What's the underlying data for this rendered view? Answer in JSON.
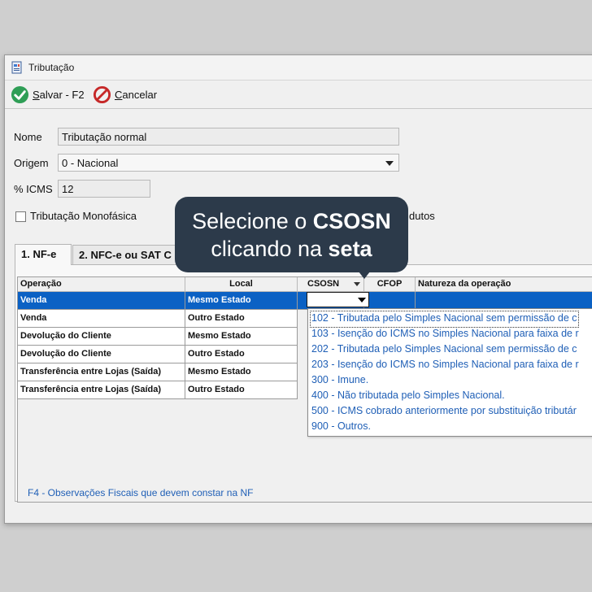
{
  "window": {
    "title": "Tributação",
    "icon": "tax-document-icon"
  },
  "toolbar": {
    "save_label": "alvar - F2",
    "save_accel": "S",
    "cancel_label": "ancelar",
    "cancel_accel": "C"
  },
  "form": {
    "nome_label": "Nome",
    "nome_value": "Tributação normal",
    "origem_label": "Origem",
    "origem_value": "0 - Nacional",
    "icms_label": "% ICMS",
    "icms_value": "12",
    "monofasica_label": "Tributação Monofásica",
    "monofasica_checked": false,
    "other_check_label_partial": "dutos"
  },
  "tabs": [
    {
      "label": "1. NF-e",
      "active": true
    },
    {
      "label": "2. NFC-e ou SAT C",
      "active": false
    }
  ],
  "grid": {
    "columns": [
      "Operação",
      "Local",
      "CSOSN",
      "CFOP",
      "Natureza da operação"
    ],
    "rows": [
      {
        "operacao": "Venda",
        "local": "Mesmo Estado",
        "selected": true
      },
      {
        "operacao": "Venda",
        "local": "Outro Estado",
        "selected": false
      },
      {
        "operacao": "Devolução do Cliente",
        "local": "Mesmo Estado",
        "selected": false
      },
      {
        "operacao": "Devolução do Cliente",
        "local": "Outro Estado",
        "selected": false
      },
      {
        "operacao": "Transferência entre Lojas (Saída)",
        "local": "Mesmo Estado",
        "selected": false
      },
      {
        "operacao": "Transferência entre Lojas (Saída)",
        "local": "Outro Estado",
        "selected": false
      }
    ],
    "footer_note": "F4 - Observações Fiscais que devem constar na NF"
  },
  "csosn_options": [
    "102 - Tributada pelo Simples Nacional sem permissão de c",
    "103 - Isenção do ICMS no Simples Nacional para faixa de r",
    "202 - Tributada pelo Simples Nacional sem permissão de c",
    "203 - Isenção do ICMS no Simples Nacional para faixa de r",
    "300 - Imune.",
    "400 - Não tributada pelo Simples Nacional.",
    "500 - ICMS cobrado anteriormente por substituição tributár",
    "900 - Outros."
  ],
  "tooltip": {
    "line1_text": "Selecione o ",
    "line1_bold": "CSOSN",
    "line2_text": "clicando na ",
    "line2_bold": "seta"
  },
  "colors": {
    "selection": "#0b61c4",
    "link_text": "#1f5fb6",
    "tooltip_bg": "#2c3a4a"
  }
}
